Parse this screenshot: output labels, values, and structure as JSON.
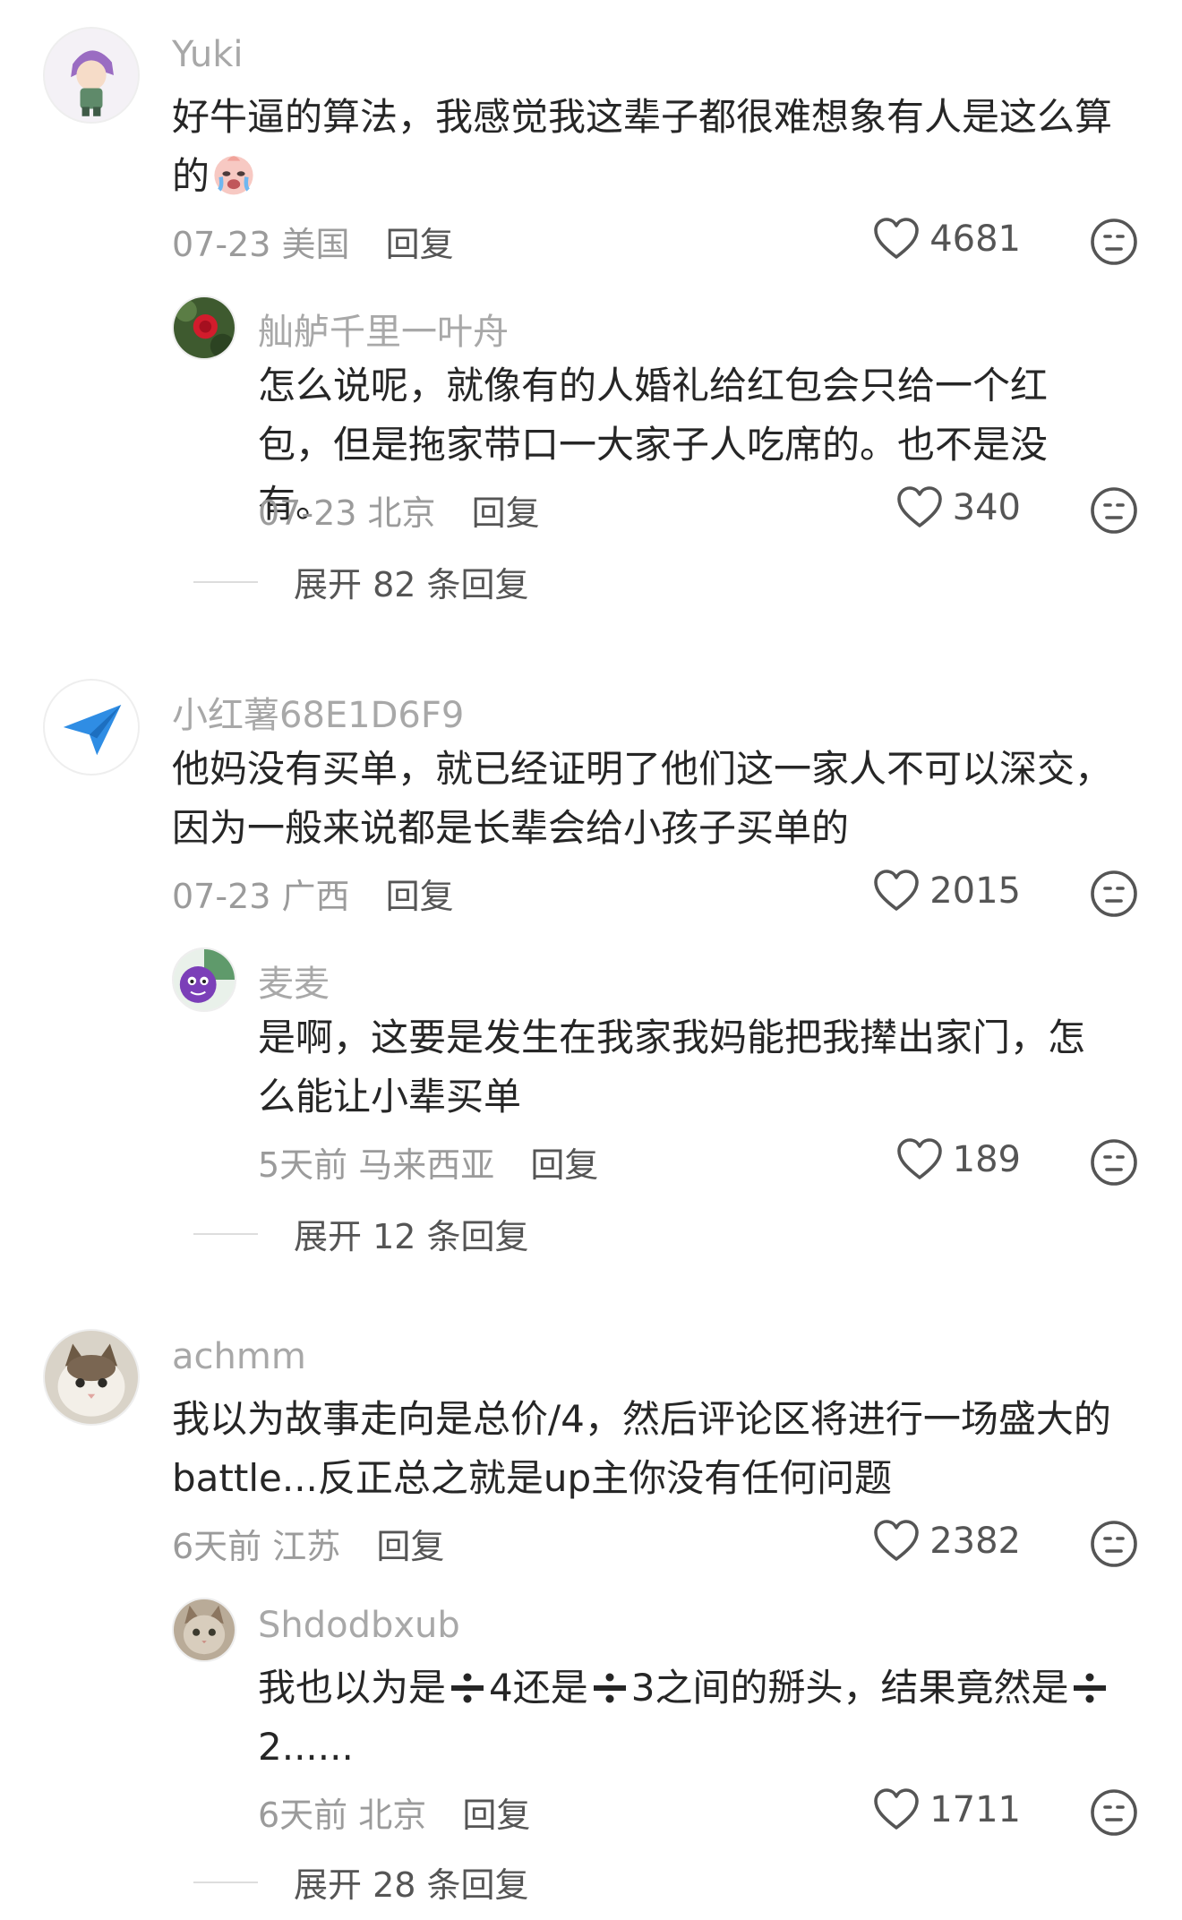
{
  "threads": [
    {
      "comment": {
        "username": "Yuki",
        "text": "好牛逼的算法，我感觉我这辈子都很难想象有人是这么算的",
        "date": "07-23",
        "location": "美国",
        "reply_label": "回复",
        "likes": "4681"
      },
      "reply": {
        "username": "舢舻千里一叶舟",
        "text": "怎么说呢，就像有的人婚礼给红包会只给一个红包，但是拖家带口一大家子人吃席的。也不是没有。",
        "date": "07-23",
        "location": "北京",
        "reply_label": "回复",
        "likes": "340"
      },
      "expand_label": "展开 82 条回复"
    },
    {
      "comment": {
        "username": "小红薯68E1D6F9",
        "text": "他妈没有买单，就已经证明了他们这一家人不可以深交，因为一般来说都是长辈会给小孩子买单的",
        "date": "07-23",
        "location": "广西",
        "reply_label": "回复",
        "likes": "2015"
      },
      "reply": {
        "username": "麦麦",
        "text": "是啊，这要是发生在我家我妈能把我撵出家门，怎么能让小辈买单",
        "date": "5天前",
        "location": "马来西亚",
        "reply_label": "回复",
        "likes": "189"
      },
      "expand_label": "展开 12 条回复"
    },
    {
      "comment": {
        "username": "achmm",
        "text": "我以为故事走向是总价/4，然后评论区将进行一场盛大的battle...反正总之就是up主你没有任何问题",
        "date": "6天前",
        "location": "江苏",
        "reply_label": "回复",
        "likes": "2382"
      },
      "reply": {
        "username": "Shdodbxub",
        "text_part1": "我也以为是",
        "text_part2": "4还是",
        "text_part3": "3之间的掰头，结果竟然是",
        "text_part4": "2......",
        "date": "6天前",
        "location": "北京",
        "reply_label": "回复",
        "likes": "1711"
      },
      "expand_label": "展开 28 条回复"
    }
  ],
  "icons": {
    "like": "heart-outline-icon",
    "reaction": "neutral-face-icon",
    "inline_emoji": "crying-face-emoji"
  }
}
